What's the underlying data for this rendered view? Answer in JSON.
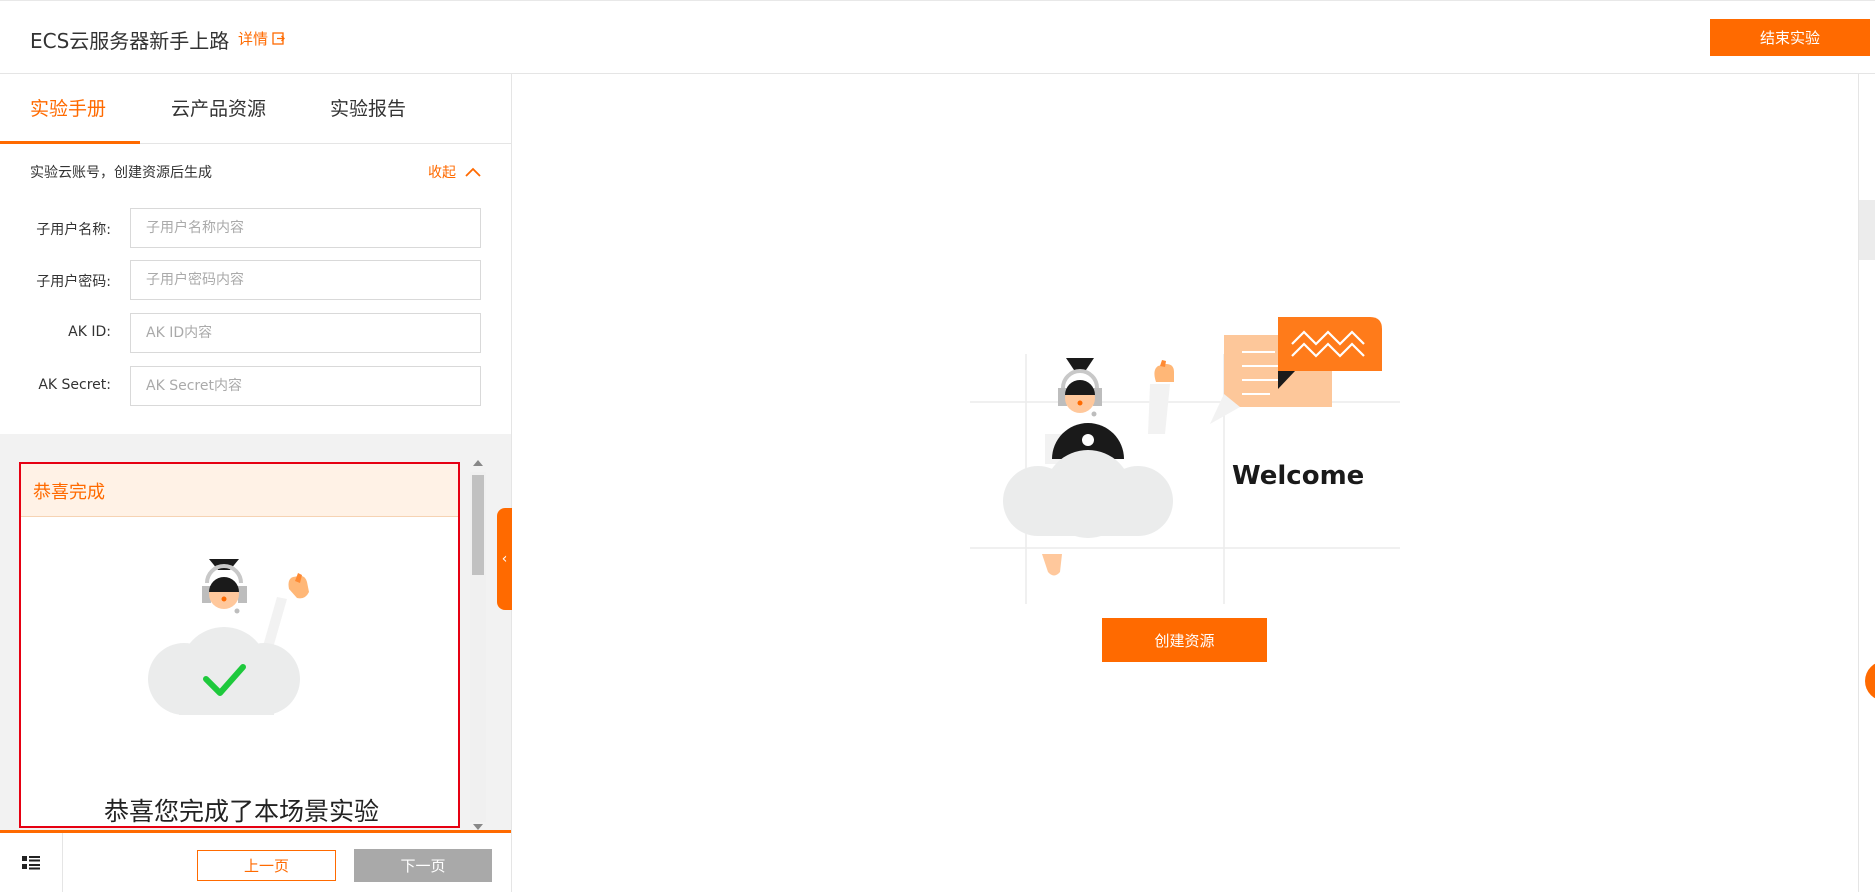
{
  "header": {
    "title": "ECS云服务器新手上路",
    "details_label": "详情",
    "end_button": "结束实验"
  },
  "tabs": [
    {
      "label": "实验手册",
      "active": true
    },
    {
      "label": "云产品资源",
      "active": false
    },
    {
      "label": "实验报告",
      "active": false
    }
  ],
  "account": {
    "notice": "实验云账号，创建资源后生成",
    "collapse_label": "收起",
    "fields": [
      {
        "label": "子用户名称:",
        "placeholder": "子用户名称内容",
        "value": ""
      },
      {
        "label": "子用户密码:",
        "placeholder": "子用户密码内容",
        "value": ""
      },
      {
        "label": "AK ID:",
        "placeholder": "AK ID内容",
        "value": ""
      },
      {
        "label": "AK Secret:",
        "placeholder": "AK Secret内容",
        "value": ""
      }
    ]
  },
  "completion_card": {
    "title": "恭喜完成",
    "message": "恭喜您完成了本场景实验"
  },
  "footer": {
    "prev_label": "上一页",
    "next_label": "下一页"
  },
  "main": {
    "welcome_text": "Welcome",
    "create_button": "创建资源"
  },
  "colors": {
    "accent": "#ff6a00",
    "card_border": "#e60012",
    "card_header_bg": "#fff2e6",
    "disabled_button": "#a9a9a9",
    "check_green": "#1ec93c"
  }
}
